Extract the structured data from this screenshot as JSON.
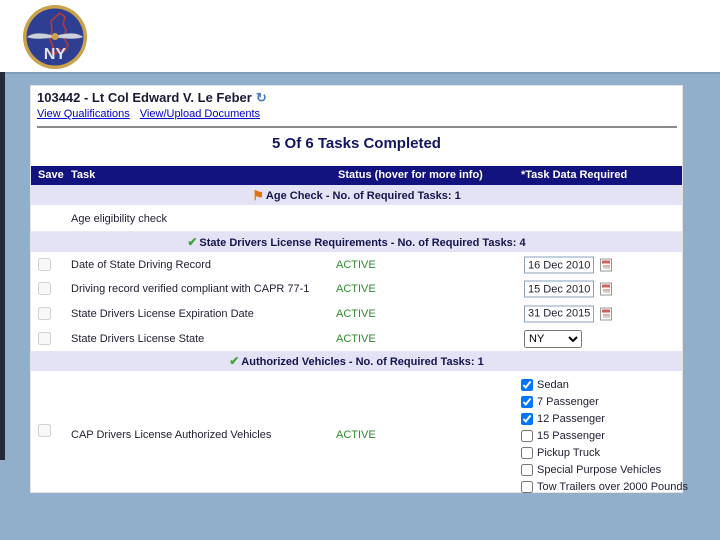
{
  "logo": {
    "text": "NY"
  },
  "member": {
    "title": "103442 - Lt Col Edward V. Le Feber",
    "link_qualifications": "View Qualifications",
    "link_documents": "View/Upload Documents"
  },
  "summary": "5 Of 6 Tasks Completed",
  "table": {
    "headers": {
      "save": "Save",
      "task": "Task",
      "status": "Status (hover for more info)",
      "data_required": "*Task Data Required"
    }
  },
  "sections": [
    {
      "title": "Age Check - No. of Required Tasks: 1",
      "icon": "orange-flag"
    },
    {
      "title": "State Drivers License Requirements - No. of Required Tasks: 4",
      "icon": "green-check"
    },
    {
      "title": "Authorized Vehicles - No. of Required Tasks: 1",
      "icon": "green-check"
    }
  ],
  "rows": {
    "age": {
      "task": "Age eligibility check"
    },
    "license": [
      {
        "task": "Date of State Driving Record",
        "status": "ACTIVE",
        "value": "16 Dec 2010"
      },
      {
        "task": "Driving record verified compliant with CAPR 77-1",
        "status": "ACTIVE",
        "value": "15 Dec 2010"
      },
      {
        "task": "State Drivers License Expiration Date",
        "status": "ACTIVE",
        "value": "31 Dec 2015"
      },
      {
        "task": "State Drivers License State",
        "status": "ACTIVE",
        "value": "NY"
      }
    ],
    "vehicles": {
      "task": "CAP Drivers License Authorized Vehicles",
      "status": "ACTIVE",
      "options": [
        {
          "label": "Sedan",
          "checked": true
        },
        {
          "label": "7 Passenger",
          "checked": true
        },
        {
          "label": "12 Passenger",
          "checked": true
        },
        {
          "label": "15 Passenger",
          "checked": false
        },
        {
          "label": "Pickup Truck",
          "checked": false
        },
        {
          "label": "Special Purpose Vehicles",
          "checked": false
        },
        {
          "label": "Tow Trailers over 2000 Pounds",
          "checked": false
        }
      ]
    }
  },
  "colors": {
    "header_bar": "#13137f",
    "section_bg": "#e3e3f5",
    "active_green": "#2e8b2e",
    "link_blue": "#0000cc",
    "slide_bg": "#91afca"
  }
}
